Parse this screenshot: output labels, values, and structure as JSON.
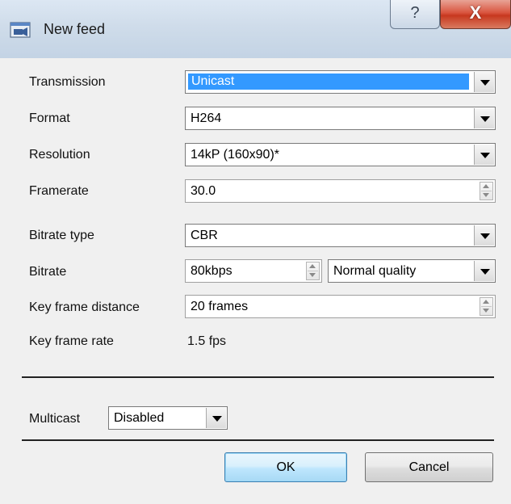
{
  "window": {
    "title": "New feed",
    "help_glyph": "?",
    "close_glyph": "X"
  },
  "form": {
    "transmission": {
      "label": "Transmission",
      "value": "Unicast"
    },
    "format": {
      "label": "Format",
      "value": "H264"
    },
    "resolution": {
      "label": "Resolution",
      "value": "14kP (160x90)*"
    },
    "framerate": {
      "label": "Framerate",
      "value": "30.0"
    },
    "bitrate_type": {
      "label": "Bitrate type",
      "value": "CBR"
    },
    "bitrate": {
      "label": "Bitrate",
      "value": "80kbps",
      "quality": "Normal quality"
    },
    "key_frame_distance": {
      "label": "Key frame distance",
      "value": "20 frames"
    },
    "key_frame_rate": {
      "label": "Key frame rate",
      "value": "1.5 fps"
    },
    "multicast": {
      "label": "Multicast",
      "value": "Disabled"
    }
  },
  "buttons": {
    "ok": "OK",
    "cancel": "Cancel"
  },
  "icons": {
    "title": "video-feed-icon"
  },
  "colors": {
    "selection": "#3399ff",
    "close": "#c7381f"
  }
}
